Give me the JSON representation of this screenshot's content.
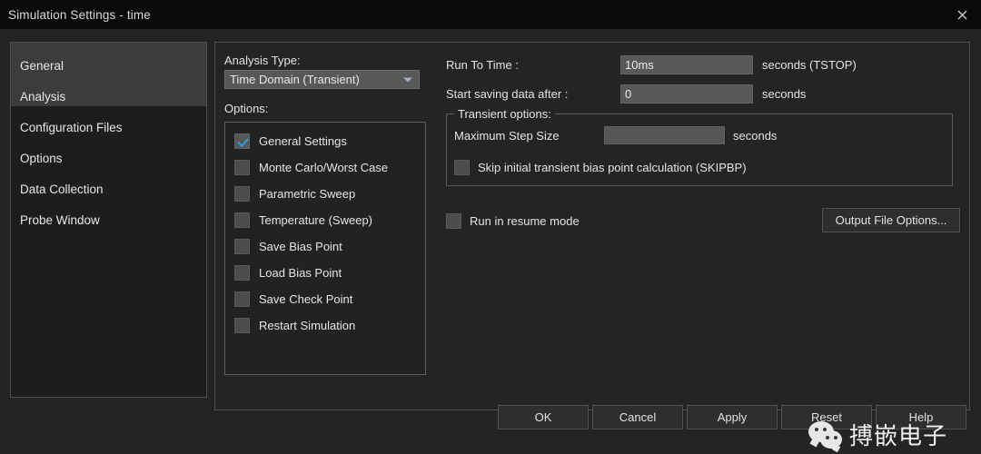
{
  "titlebar": {
    "title": "Simulation Settings - time",
    "close_icon": "close-icon"
  },
  "sidebar": {
    "items": [
      {
        "label": "General"
      },
      {
        "label": "Analysis"
      },
      {
        "label": "Configuration Files"
      },
      {
        "label": "Options"
      },
      {
        "label": "Data Collection"
      },
      {
        "label": "Probe Window"
      }
    ]
  },
  "analysis": {
    "type_label": "Analysis Type:",
    "type_value": "Time Domain (Transient)",
    "options_label": "Options:",
    "options": [
      {
        "label": "General Settings",
        "checked": true
      },
      {
        "label": "Monte Carlo/Worst Case",
        "checked": false
      },
      {
        "label": "Parametric Sweep",
        "checked": false
      },
      {
        "label": "Temperature (Sweep)",
        "checked": false
      },
      {
        "label": "Save Bias Point",
        "checked": false
      },
      {
        "label": "Load Bias Point",
        "checked": false
      },
      {
        "label": "Save Check Point",
        "checked": false
      },
      {
        "label": "Restart Simulation",
        "checked": false
      }
    ]
  },
  "settings": {
    "run_to_time_label": "Run To Time :",
    "run_to_time_value": "10ms",
    "run_to_time_unit": "seconds (TSTOP)",
    "start_saving_label": "Start saving data after :",
    "start_saving_value": "0",
    "start_saving_unit": "seconds",
    "transient": {
      "group_title": "Transient options:",
      "max_step_label": "Maximum Step Size",
      "max_step_value": "",
      "max_step_unit": "seconds",
      "skipbp_label": "Skip initial transient bias point calculation (SKIPBP)",
      "skipbp_checked": false
    },
    "resume_label": "Run in resume mode",
    "resume_checked": false,
    "output_file_options_label": "Output File Options..."
  },
  "buttons": {
    "ok": "OK",
    "cancel": "Cancel",
    "apply": "Apply",
    "reset": "Reset",
    "help": "Help"
  },
  "watermark": {
    "text": "搏嵌电子",
    "logo_icon": "wechat-logo-icon"
  },
  "colors": {
    "window_bg": "#232424",
    "titlebar_bg": "#0a0a0a",
    "panel_border": "#4d4f4d",
    "field_bg": "#575858",
    "accent_check": "#29a0e8",
    "text": "#e6e6e6",
    "highlight": "#3b3c3c"
  }
}
